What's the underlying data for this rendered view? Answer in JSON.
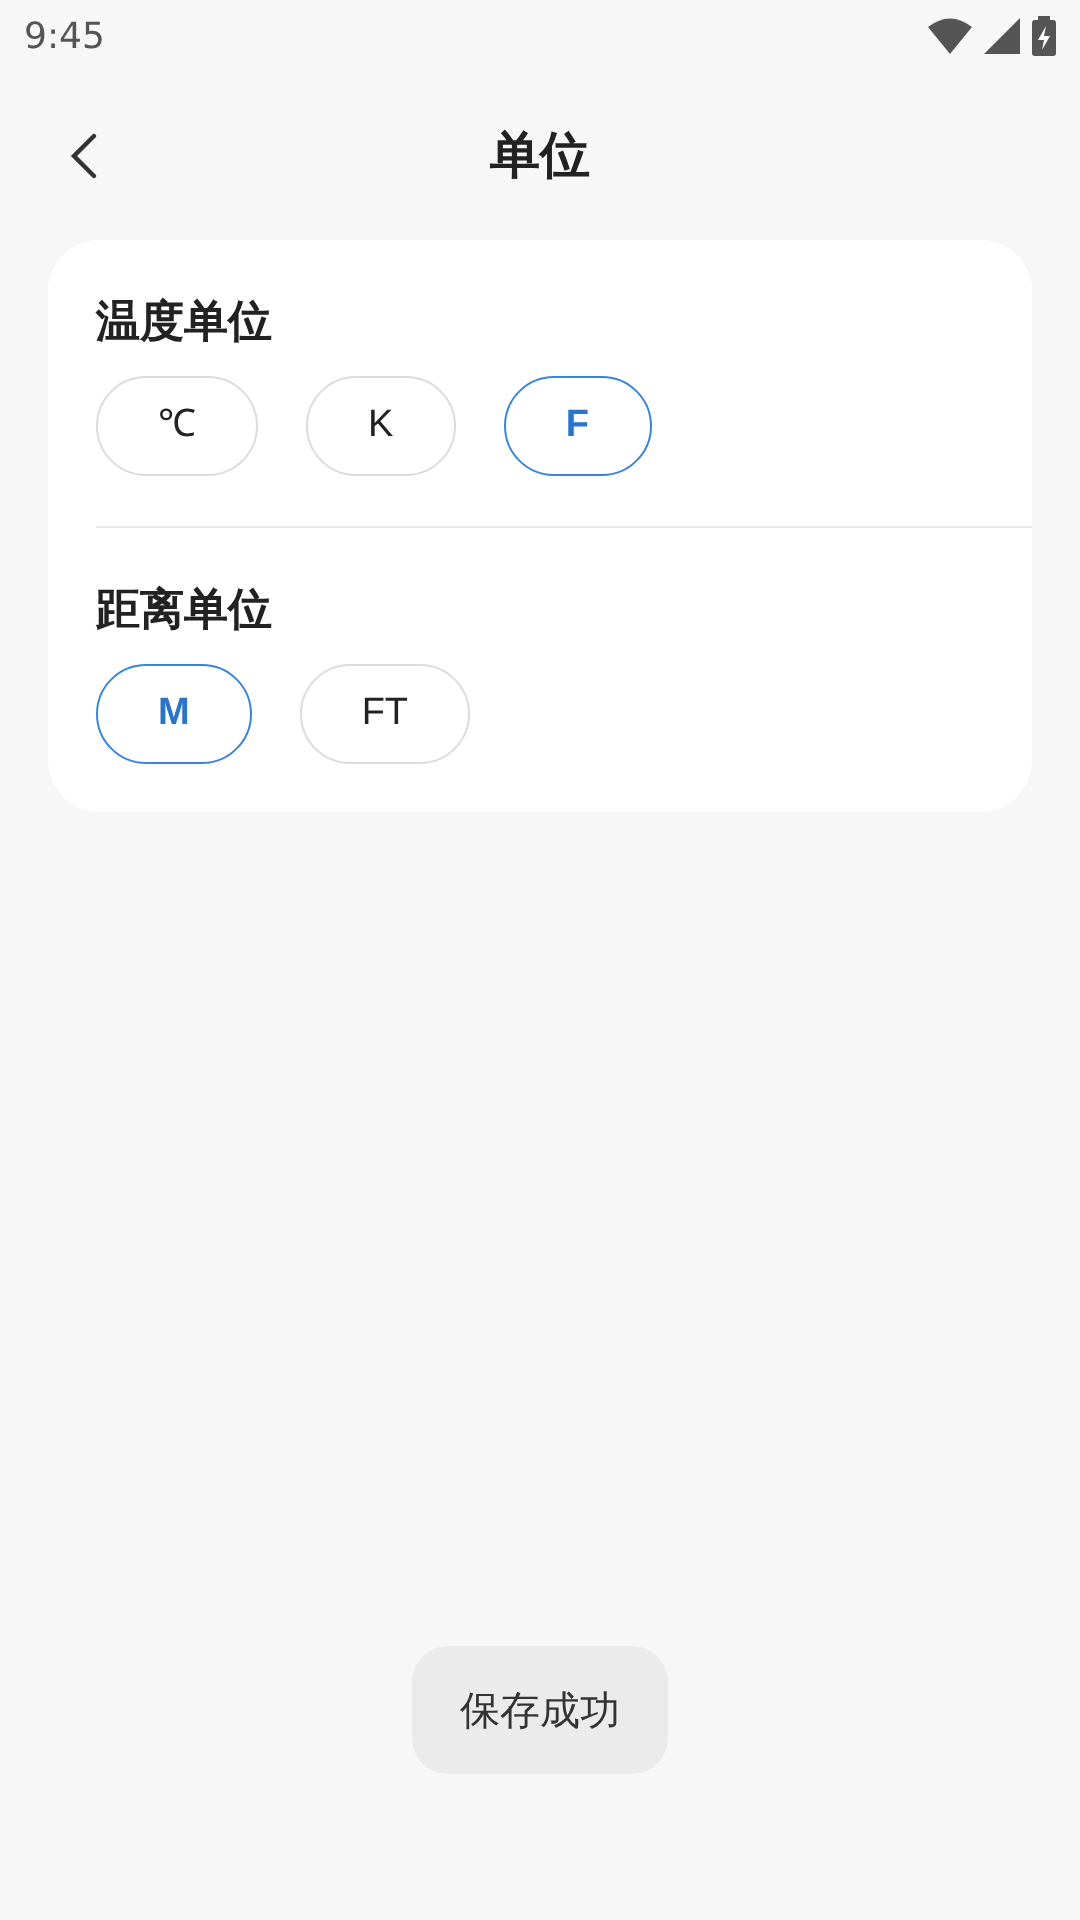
{
  "status_bar": {
    "time": "9:45"
  },
  "header": {
    "title": "单位"
  },
  "sections": [
    {
      "title": "温度单位",
      "options": [
        {
          "label": "℃",
          "selected": false
        },
        {
          "label": "K",
          "selected": false
        },
        {
          "label": "F",
          "selected": true
        }
      ]
    },
    {
      "title": "距离单位",
      "options": [
        {
          "label": "M",
          "selected": true
        },
        {
          "label": "FT",
          "selected": false
        }
      ]
    }
  ],
  "toast": {
    "text": "保存成功"
  }
}
